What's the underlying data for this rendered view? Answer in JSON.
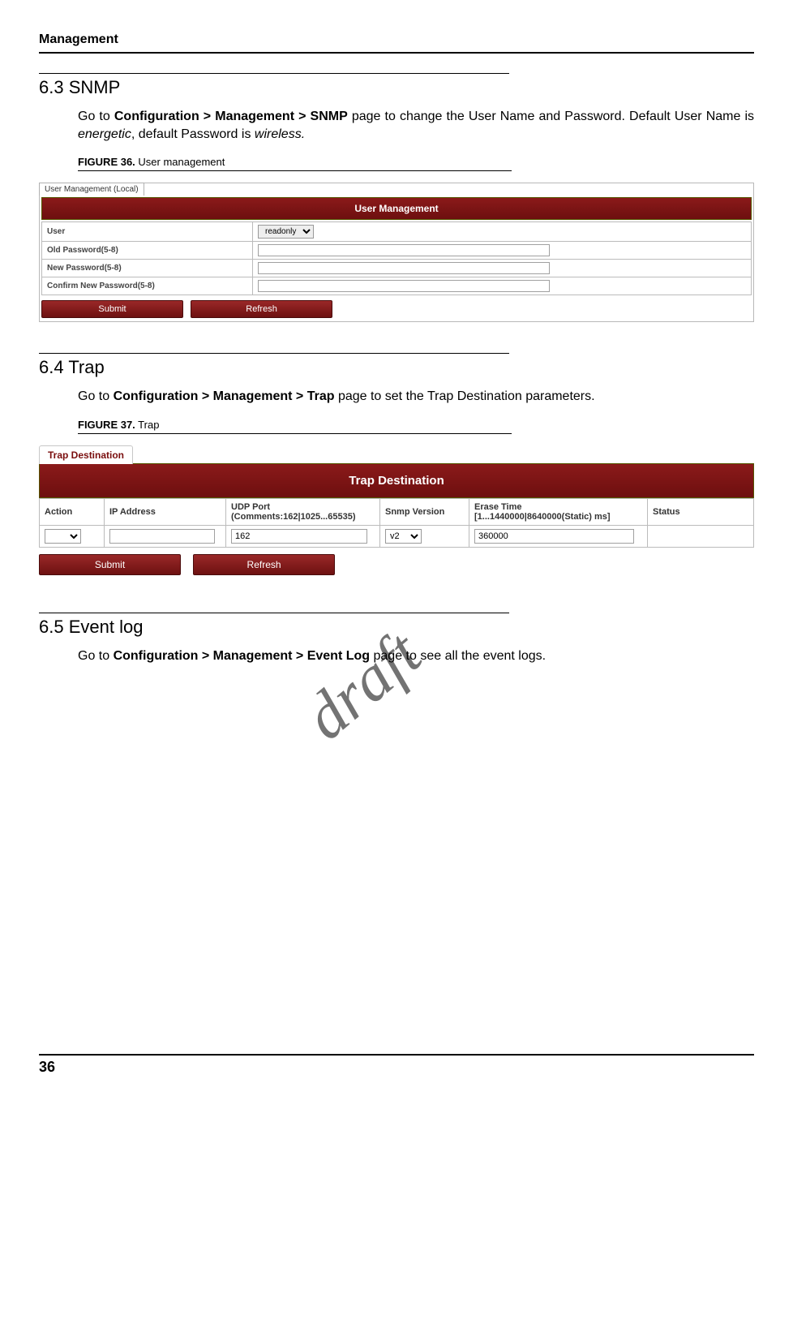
{
  "header": {
    "title": "Management"
  },
  "section_snmp": {
    "number": "6.3",
    "title": "SNMP",
    "body_pre": "Go to ",
    "body_bold": "Configuration > Management > SNMP",
    "body_mid": " page to change the User Name and Password. Default User Name is ",
    "body_italic1": "energetic",
    "body_mid2": ", default Password is ",
    "body_italic2": "wireless.",
    "figure_label": "FIGURE 36.",
    "figure_title": " User management"
  },
  "um": {
    "tab": "User Management (Local)",
    "banner": "User Management",
    "rows": {
      "user_label": "User",
      "user_value": "readonly",
      "old_pw_label": "Old Password(5-8)",
      "new_pw_label": "New Password(5-8)",
      "confirm_pw_label": "Confirm New Password(5-8)"
    },
    "submit": "Submit",
    "refresh": "Refresh"
  },
  "section_trap": {
    "number": "6.4",
    "title": "Trap",
    "body_pre": "Go to ",
    "body_bold": "Configuration > Management > Trap",
    "body_post": " page to set the Trap Destination parameters.",
    "figure_label": "FIGURE 37.",
    "figure_title": " Trap"
  },
  "trap": {
    "tab": "Trap Destination",
    "banner": "Trap Destination",
    "headers": {
      "action": "Action",
      "ip": "IP Address",
      "udp": "UDP Port\n(Comments:162|1025...65535)",
      "snmp": "Snmp Version",
      "erase": "Erase Time\n[1...1440000|8640000(Static) ms]",
      "status": "Status"
    },
    "row": {
      "udp_value": "162",
      "snmp_value": "v2",
      "erase_value": "360000"
    },
    "submit": "Submit",
    "refresh": "Refresh"
  },
  "section_eventlog": {
    "number": "6.5",
    "title": "Event log",
    "body_pre": "Go to ",
    "body_bold": "Configuration > Management > Event Log",
    "body_post": " page to see all the event logs."
  },
  "watermark": "draft",
  "page_number": "36"
}
